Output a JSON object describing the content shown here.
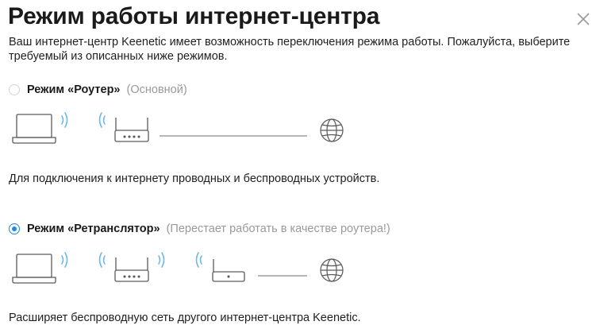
{
  "dialog": {
    "title": "Режим работы интернет-центра",
    "description": "Ваш интернет-центр Keenetic имеет возможность переключения режима работы. Пожалуйста, выберите требуемый из описанных ниже режимов.",
    "close_icon": "close-icon"
  },
  "colors": {
    "accent": "#1e88e5",
    "icon_stroke": "#5a5a5a",
    "wifi": "#6fb6ea",
    "muted_text": "#9a9a9a"
  },
  "modes": [
    {
      "label": "Режим «Роутер»",
      "note": "(Основной)",
      "selected": false,
      "description": "Для подключения к интернету проводных и беспроводных устройств."
    },
    {
      "label": "Режим «Ретранслятор»",
      "note": "(Перестает работать в качестве роутера!)",
      "selected": true,
      "description": "Расширяет беспроводную сеть другого интернет-центра Keenetic."
    }
  ]
}
